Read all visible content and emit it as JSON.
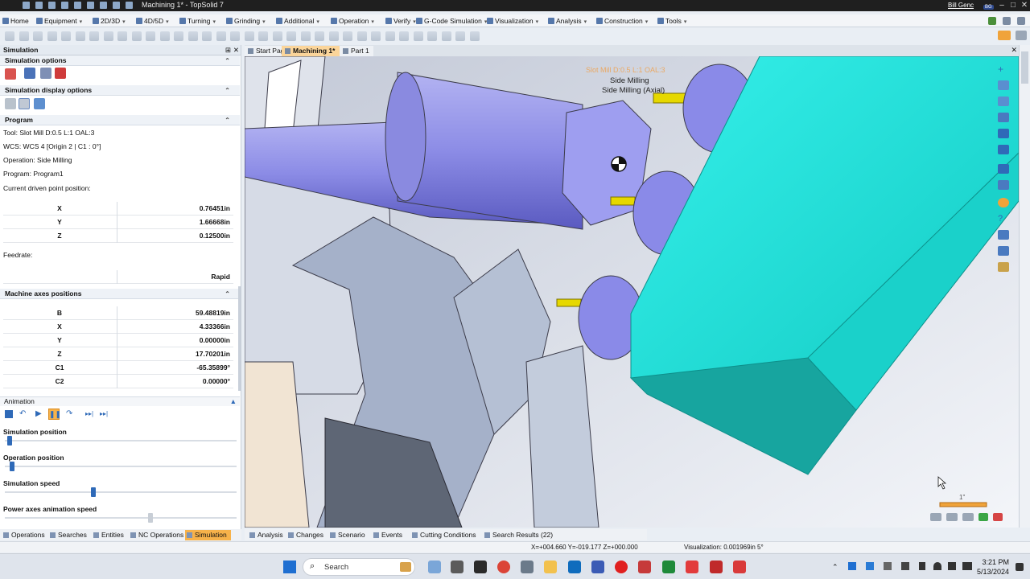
{
  "app": {
    "title": "Machining 1* - TopSolid 7",
    "user": "Bill Genc",
    "user_badge": "BG"
  },
  "menu": [
    {
      "label": "Home"
    },
    {
      "label": "Equipment"
    },
    {
      "label": "2D/3D"
    },
    {
      "label": "4D/5D"
    },
    {
      "label": "Turning"
    },
    {
      "label": "Grinding"
    },
    {
      "label": "Additional"
    },
    {
      "label": "Operation"
    },
    {
      "label": "Verify"
    },
    {
      "label": "G-Code Simulation"
    },
    {
      "label": "Visualization"
    },
    {
      "label": "Analysis"
    },
    {
      "label": "Construction"
    },
    {
      "label": "Tools"
    }
  ],
  "panel": {
    "title": "Simulation",
    "sections": {
      "sim_options": "Simulation options",
      "display_options": "Simulation display options",
      "program": "Program",
      "machine_axes": "Machine axes positions",
      "animation": "Animation"
    },
    "tool": "Tool: Slot Mill D:0.5 L:1 OAL:3",
    "wcs": "WCS: WCS 4 [Origin 2 | C1 : 0°]",
    "operation": "Operation: Side Milling",
    "program_name": "Program: Program1",
    "driven_point_label": "Current driven point position:",
    "driven_point": [
      {
        "axis": "X",
        "value": "0.76451in"
      },
      {
        "axis": "Y",
        "value": "1.66668in"
      },
      {
        "axis": "Z",
        "value": "0.12500in"
      }
    ],
    "feedrate_label": "Feedrate:",
    "feedrate_value": "Rapid",
    "machine_axes": [
      {
        "axis": "B",
        "value": "59.48819in"
      },
      {
        "axis": "X",
        "value": "4.33366in"
      },
      {
        "axis": "Y",
        "value": "0.00000in"
      },
      {
        "axis": "Z",
        "value": "17.70201in"
      },
      {
        "axis": "C1",
        "value": "-65.35899°"
      },
      {
        "axis": "C2",
        "value": "0.00000°"
      }
    ],
    "sliders": {
      "sim_position": {
        "label": "Simulation position",
        "fraction": 0.01
      },
      "op_position": {
        "label": "Operation position",
        "fraction": 0.02
      },
      "sim_speed": {
        "label": "Simulation speed",
        "fraction": 0.38
      },
      "power_speed": {
        "label": "Power axes animation speed",
        "fraction": 0.63
      }
    }
  },
  "doc_tabs": [
    {
      "label": "Start Page"
    },
    {
      "label": "Machining 1*"
    },
    {
      "label": "Part 1"
    }
  ],
  "viewport": {
    "op_label_1": "Slot Mill D:0.5 L:1 OAL:3",
    "op_label_2": "Side Milling",
    "op_label_3": "Side Milling (Axial)",
    "scale_label": "1\""
  },
  "bottom_tabs": [
    {
      "label": "Operations"
    },
    {
      "label": "Searches"
    },
    {
      "label": "Entities"
    },
    {
      "label": "NC Operations"
    },
    {
      "label": "Simulation"
    }
  ],
  "view_tabs": [
    {
      "label": "Analysis"
    },
    {
      "label": "Changes"
    },
    {
      "label": "Scenario"
    },
    {
      "label": "Events"
    },
    {
      "label": "Cutting Conditions"
    },
    {
      "label": "Search Results (22)"
    }
  ],
  "status": {
    "coords": "X=+004.660   Y=-019.177   Z=+000.000",
    "visualization": "Visualization: 0.001969in 5°"
  },
  "taskbar": {
    "search_placeholder": "Search",
    "time": "3:21 PM",
    "date": "5/13/2024"
  },
  "colors": {
    "accent": "#2f6ab8",
    "part": "#20e0d8",
    "tool": "#8f8fe8",
    "sim_tab": "#f5a623"
  }
}
